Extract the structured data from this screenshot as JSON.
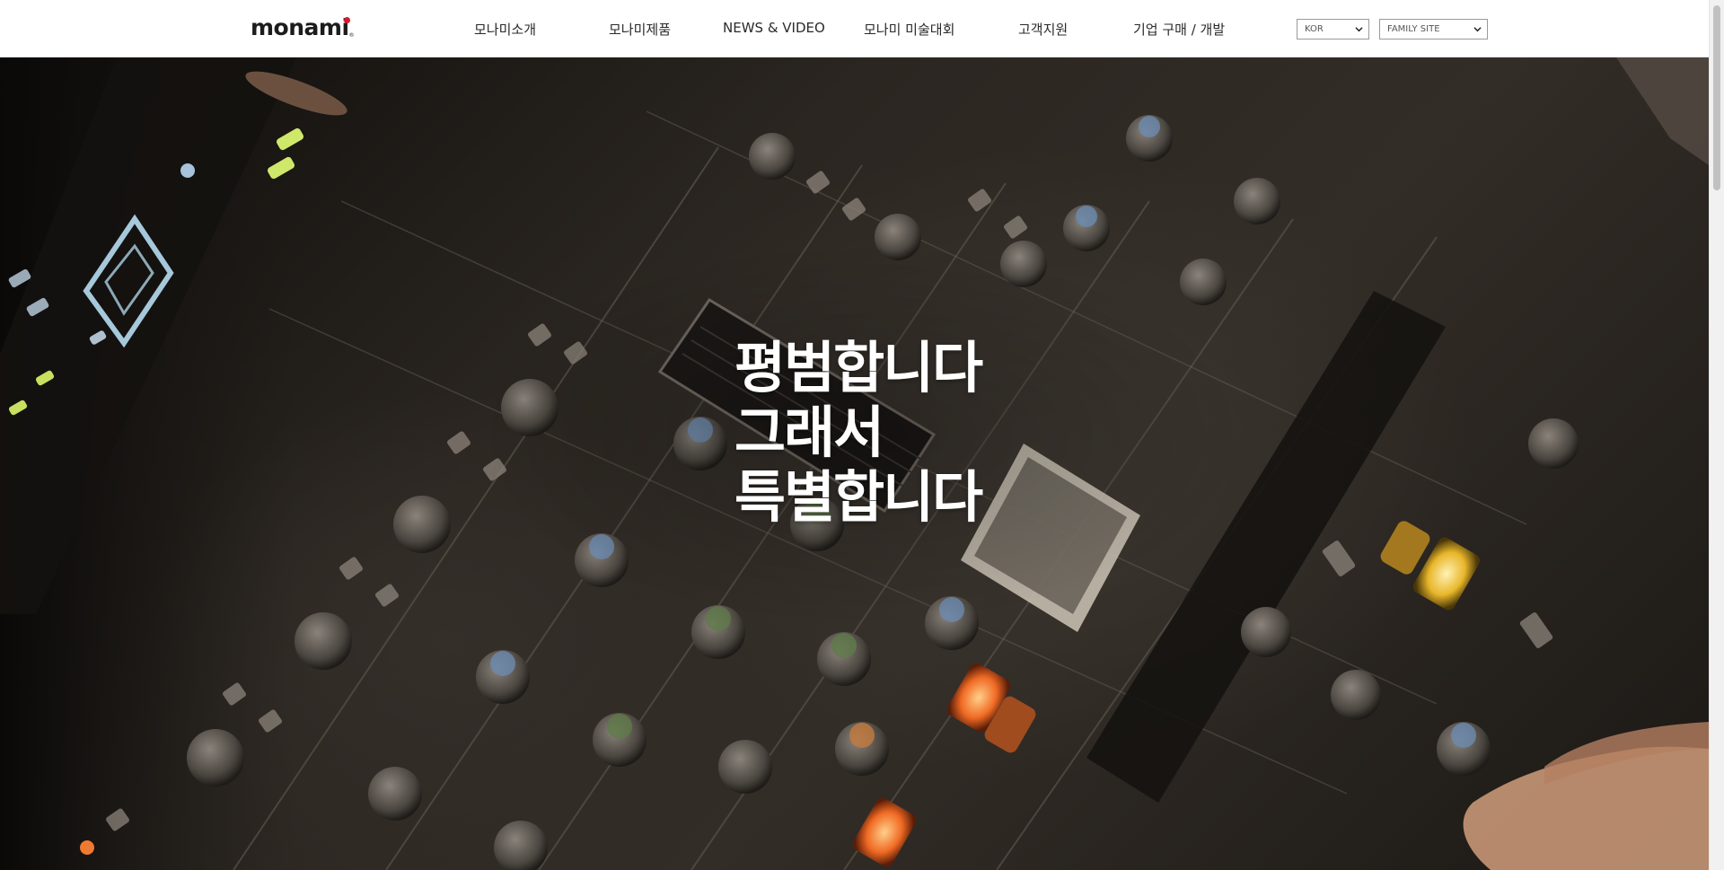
{
  "header": {
    "logo_text": "monami",
    "logo_reg": "®",
    "nav": [
      {
        "label": "모나미소개"
      },
      {
        "label": "모나미제품"
      },
      {
        "label": "NEWS & VIDEO"
      },
      {
        "label": "모나미 미술대회"
      },
      {
        "label": "고객지원"
      },
      {
        "label": "기업 구매 / 개발"
      }
    ],
    "language_select": {
      "value": "KOR"
    },
    "family_site_select": {
      "value": "FAMILY SITE"
    }
  },
  "hero": {
    "headline": [
      "평범합니다",
      "그래서",
      "특별합니다"
    ]
  },
  "colors": {
    "brand_red": "#d7172f",
    "header_bg": "#ffffff",
    "text_dark": "#2a2a2a"
  }
}
